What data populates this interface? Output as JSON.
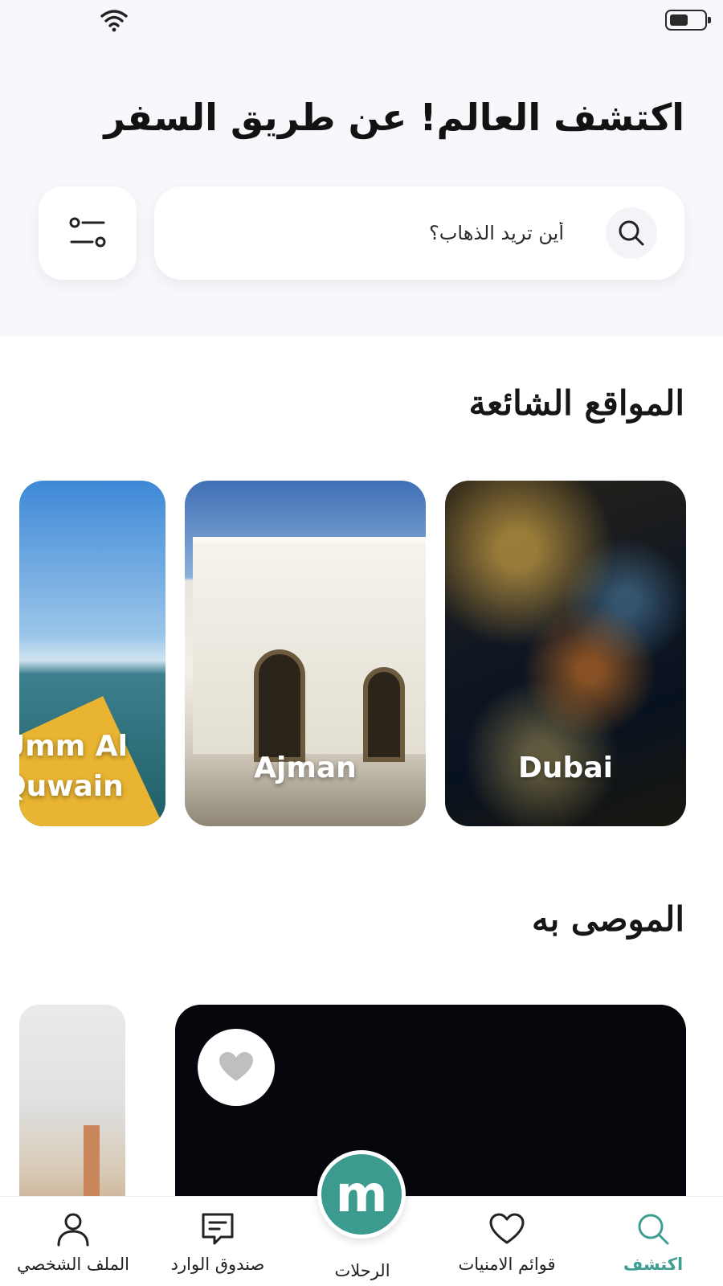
{
  "header": {
    "title": "اكتشف العالم! عن طريق السفر"
  },
  "search": {
    "placeholder": "أين تريد الذهاب؟"
  },
  "popular": {
    "title": "المواقع الشائعة",
    "cards": [
      {
        "label": "Dubai"
      },
      {
        "label": "Ajman"
      },
      {
        "label": "Umm Al\nQuwain"
      }
    ]
  },
  "recommended": {
    "title": "الموصى به"
  },
  "nav": {
    "logo_letter": "m",
    "items": [
      {
        "id": "explore",
        "label": "اكتشف",
        "icon": "search-icon",
        "active": true
      },
      {
        "id": "wishlists",
        "label": "قوائم الامنيات",
        "icon": "heart-icon"
      },
      {
        "id": "trips",
        "label": "الرحلات",
        "icon": "m-logo-icon"
      },
      {
        "id": "inbox",
        "label": "صندوق الوارد",
        "icon": "message-icon"
      },
      {
        "id": "profile",
        "label": "الملف الشخصي",
        "icon": "user-icon"
      }
    ]
  },
  "colors": {
    "accent": "#3b9b8f",
    "active_nav": "#3f9e92"
  }
}
